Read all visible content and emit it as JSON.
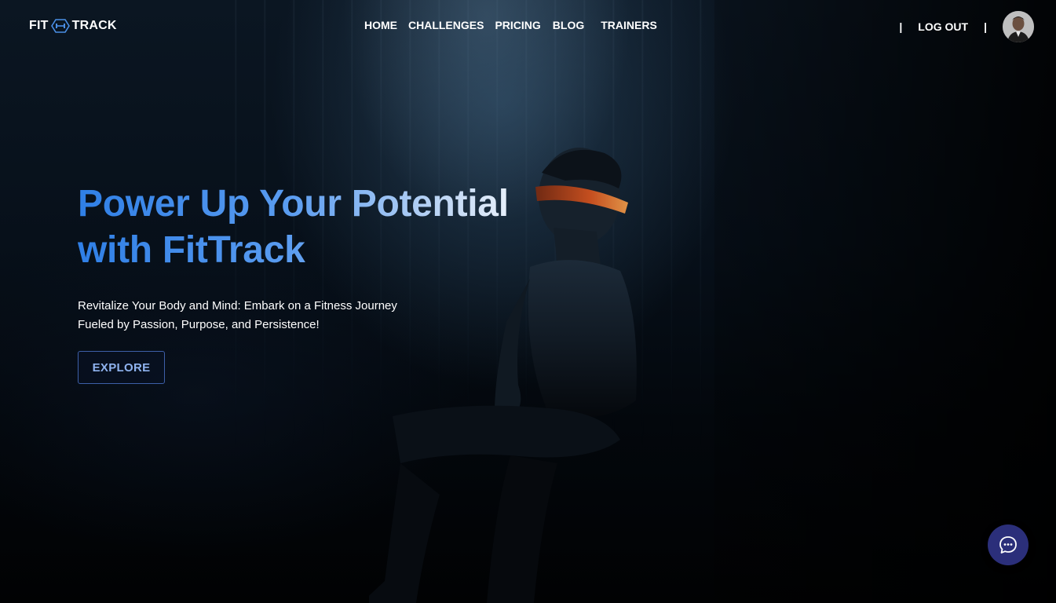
{
  "brand": {
    "name_left": "FIT",
    "name_right": "TRACK",
    "icon": "dumbbell-icon"
  },
  "nav": {
    "links": [
      {
        "label": "HOME"
      },
      {
        "label": "CHALLENGES"
      },
      {
        "label": "PRICING"
      },
      {
        "label": "BLOG"
      },
      {
        "label": "TRAINERS"
      }
    ],
    "separator": "|",
    "logout_label": "LOG OUT",
    "avatar_icon": "user-avatar"
  },
  "hero": {
    "title_line1": "Power Up Your Potential",
    "title_line2": "with FitTrack",
    "subtitle": "Revitalize Your Body and Mind: Embark on a Fitness Journey Fueled by Passion, Purpose, and Persistence!",
    "cta_label": "EXPLORE"
  },
  "chat": {
    "icon": "chat-bubble-icon"
  },
  "colors": {
    "accent": "#2f7fe6",
    "chat_bg": "#2b2f7a",
    "button_border": "#3d5fa8"
  }
}
